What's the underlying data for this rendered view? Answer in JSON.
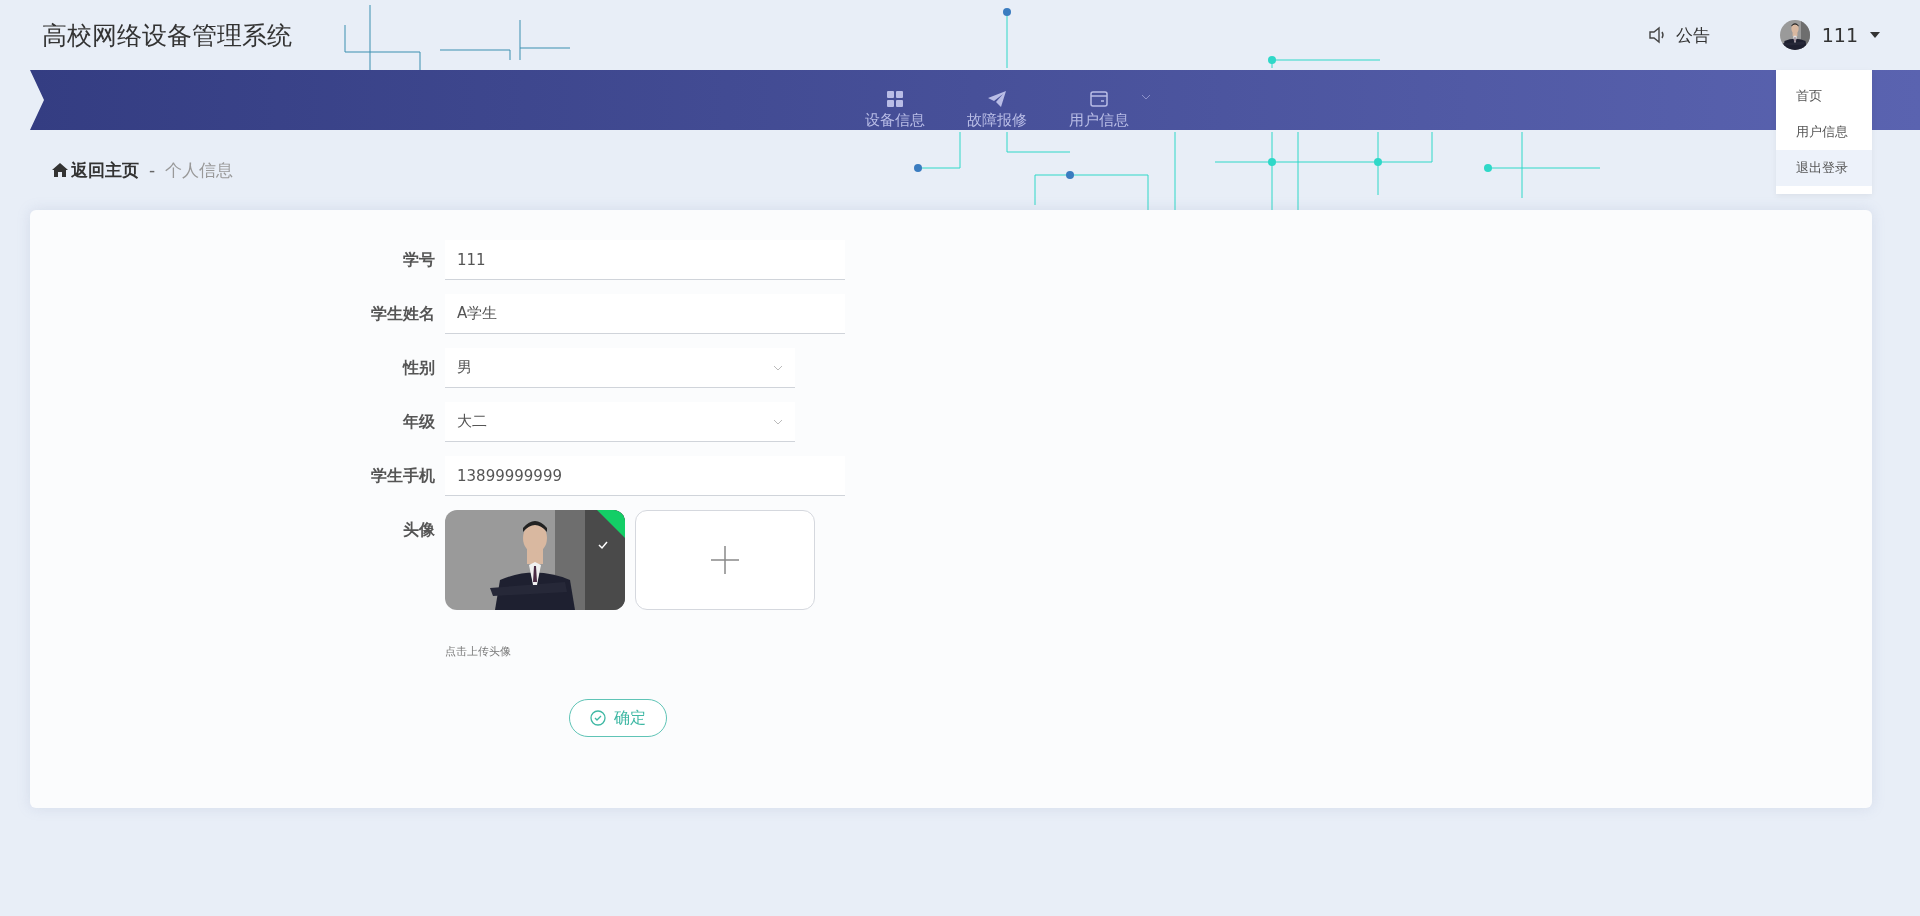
{
  "header": {
    "title": "高校网络设备管理系统",
    "notice": "公告",
    "user": "111"
  },
  "nav": [
    {
      "label": "设备信息",
      "has_dropdown": false
    },
    {
      "label": "故障报修",
      "has_dropdown": false
    },
    {
      "label": "用户信息",
      "has_dropdown": true
    }
  ],
  "user_menu": [
    {
      "label": "首页",
      "hovered": false
    },
    {
      "label": "用户信息",
      "hovered": false
    },
    {
      "label": "退出登录",
      "hovered": true
    }
  ],
  "breadcrumb": {
    "home": "返回主页",
    "separator": "-",
    "current": "个人信息"
  },
  "form": {
    "fields": [
      {
        "label": "学号",
        "kind": "text",
        "value": "111"
      },
      {
        "label": "学生姓名",
        "kind": "text",
        "value": "A学生"
      },
      {
        "label": "性别",
        "kind": "select",
        "value": "男"
      },
      {
        "label": "年级",
        "kind": "select",
        "value": "大二"
      },
      {
        "label": "学生手机",
        "kind": "text",
        "value": "13899999999"
      }
    ],
    "avatar": {
      "label": "头像",
      "hint": "点击上传头像",
      "uploaded": true
    },
    "submit": "确定"
  }
}
